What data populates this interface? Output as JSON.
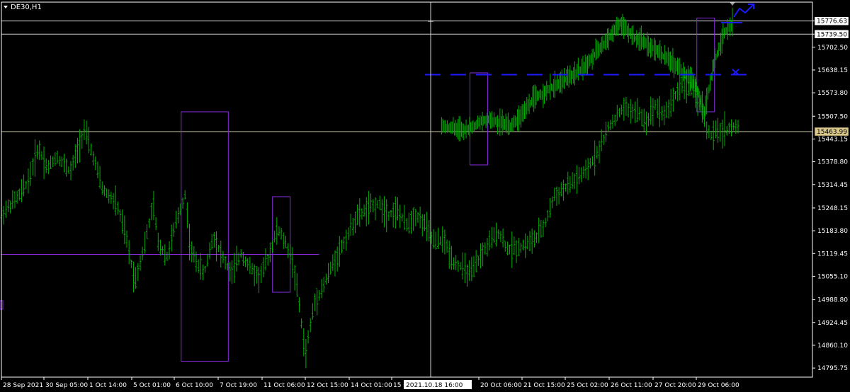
{
  "symbol_label": "DE30,H1",
  "crosshair_time_label": "2021.10.18 16:00",
  "price_tags": [
    {
      "label": "15776.63",
      "value": 15776.63,
      "style": "line"
    },
    {
      "label": "15739.50",
      "value": 15739.5,
      "style": "line"
    },
    {
      "label": "15463.99",
      "value": 15463.99,
      "style": "marker"
    }
  ],
  "colors": {
    "background": "#000000",
    "bars": "#00b000",
    "axis": "#ffffff",
    "zone_box": "#8a2be2",
    "level_line": "#1a1aff",
    "marker_tag_bg": "#d9c88a"
  },
  "chart_data": {
    "type": "bar",
    "title": "DE30,H1",
    "ylim": [
      14770,
      15830
    ],
    "y_ticks": [
      "15776.63",
      "15739.50",
      "15702.50",
      "15638.15",
      "15573.80",
      "15507.50",
      "15443.15",
      "15378.80",
      "15314.45",
      "15248.15",
      "15183.80",
      "15119.45",
      "15055.10",
      "14988.80",
      "14924.45",
      "14860.10",
      "14795.75"
    ],
    "x_ticks": [
      "28 Sep 2021",
      "30 Sep 05:00",
      "1 Oct 14:00",
      "5 Oct 01:00",
      "6 Oct 10:00",
      "7 Oct 19:00",
      "11 Oct 06:00",
      "12 Oct 15:00",
      "14 Oct 01:00",
      "15 O",
      "20 Oct 06:00",
      "21 Oct 15:00",
      "25 Oct 02:00",
      "26 Oct 11:00",
      "27 Oct 20:00",
      "29 Oct 06:00"
    ],
    "x_range": [
      0,
      160
    ],
    "price_path": [
      [
        0,
        15230
      ],
      [
        4,
        15285
      ],
      [
        6,
        15330
      ],
      [
        8,
        15420
      ],
      [
        10,
        15360
      ],
      [
        12,
        15395
      ],
      [
        15,
        15350
      ],
      [
        18,
        15470
      ],
      [
        20,
        15390
      ],
      [
        22,
        15300
      ],
      [
        25,
        15260
      ],
      [
        27,
        15170
      ],
      [
        29,
        15040
      ],
      [
        31,
        15140
      ],
      [
        33,
        15260
      ],
      [
        34,
        15150
      ],
      [
        36,
        15110
      ],
      [
        38,
        15210
      ],
      [
        40,
        15290
      ],
      [
        41,
        15130
      ],
      [
        44,
        15060
      ],
      [
        46,
        15170
      ],
      [
        48,
        15110
      ],
      [
        50,
        15060
      ],
      [
        52,
        15120
      ],
      [
        54,
        15080
      ],
      [
        56,
        15050
      ],
      [
        58,
        15110
      ],
      [
        60,
        15190
      ],
      [
        62,
        15140
      ],
      [
        63,
        15110
      ],
      [
        64,
        15040
      ],
      [
        65,
        14940
      ],
      [
        66,
        14830
      ],
      [
        67,
        14910
      ],
      [
        68,
        14980
      ],
      [
        70,
        15030
      ],
      [
        72,
        15090
      ],
      [
        74,
        15140
      ],
      [
        77,
        15220
      ],
      [
        80,
        15250
      ],
      [
        82,
        15260
      ],
      [
        84,
        15230
      ],
      [
        86,
        15240
      ],
      [
        88,
        15200
      ],
      [
        90,
        15230
      ],
      [
        92,
        15200
      ],
      [
        94,
        15150
      ],
      [
        96,
        15160
      ],
      [
        98,
        15100
      ],
      [
        100,
        15080
      ],
      [
        102,
        15060
      ],
      [
        104,
        15110
      ],
      [
        106,
        15150
      ],
      [
        108,
        15180
      ],
      [
        110,
        15130
      ],
      [
        113,
        15140
      ],
      [
        116,
        15160
      ],
      [
        118,
        15200
      ],
      [
        120,
        15280
      ],
      [
        124,
        15320
      ],
      [
        127,
        15350
      ],
      [
        130,
        15420
      ],
      [
        132,
        15480
      ],
      [
        135,
        15530
      ],
      [
        138,
        15520
      ],
      [
        140,
        15490
      ],
      [
        142,
        15540
      ],
      [
        144,
        15510
      ],
      [
        146,
        15560
      ],
      [
        148,
        15600
      ],
      [
        150,
        15580
      ],
      [
        152,
        15540
      ],
      [
        153,
        15480
      ],
      [
        154,
        15450
      ],
      [
        155,
        15460
      ],
      [
        160,
        15480
      ]
    ],
    "zone_boxes": [
      {
        "x0": 61,
        "x1": 77,
        "high": 15520,
        "low": 14815
      },
      {
        "x0": 92,
        "x1": 98,
        "high": 15280,
        "low": 15010
      },
      {
        "x0": 159,
        "x1": 165,
        "high": 15630,
        "low": 15370
      },
      {
        "x0": 236,
        "x1": 242,
        "high": 15785,
        "low": 15520
      }
    ],
    "level_line": {
      "value": 15625.0
    }
  }
}
